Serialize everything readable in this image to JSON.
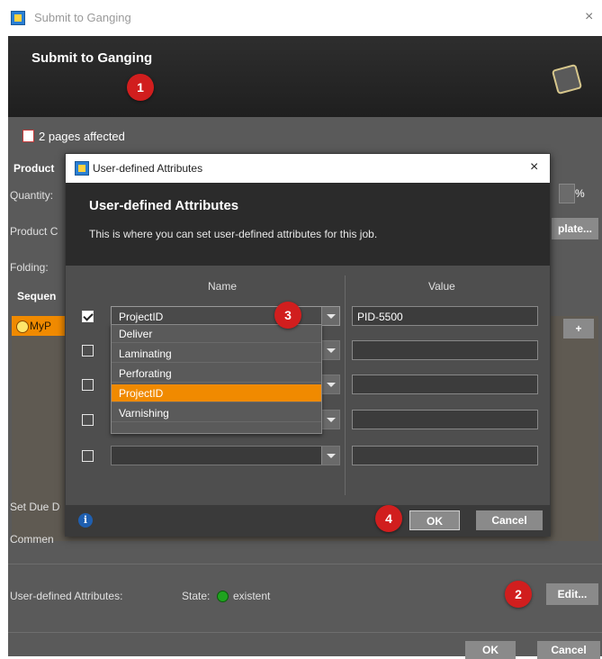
{
  "window": {
    "title": "Submit to Ganging",
    "close_glyph": "×"
  },
  "header": {
    "title": "Submit to Ganging"
  },
  "main": {
    "pages_affected": "2 pages affected",
    "labels": {
      "product": "Product",
      "quantity": "Quantity:",
      "product_c": "Product C",
      "folding": "Folding:",
      "sequence": "Sequen",
      "set_due": "Set Due D",
      "comment": "Commen"
    },
    "percent": "%",
    "plate_button": "plate...",
    "myp_item": "MyP",
    "plus_button": "+",
    "user_defined": {
      "label": "User-defined Attributes:",
      "state_label": "State:",
      "state_value": "existent",
      "state_color": "#1fa31f"
    },
    "edit_button": "Edit...",
    "ok_button": "OK",
    "cancel_button": "Cancel"
  },
  "dialog": {
    "title": "User-defined Attributes",
    "close_glyph": "×",
    "header_title": "User-defined Attributes",
    "header_subtitle": "This is where you can set user-defined attributes for this job.",
    "columns": {
      "name": "Name",
      "value": "Value"
    },
    "rows": [
      {
        "checked": true,
        "name": "ProjectID",
        "value": "PID-5500"
      },
      {
        "checked": false,
        "name": "",
        "value": ""
      },
      {
        "checked": false,
        "name": "",
        "value": ""
      },
      {
        "checked": false,
        "name": "",
        "value": ""
      },
      {
        "checked": false,
        "name": "",
        "value": ""
      }
    ],
    "dropdown_options": [
      "Deliver",
      "Laminating",
      "Perforating",
      "ProjectID",
      "Varnishing"
    ],
    "dropdown_selected": "ProjectID",
    "info_glyph": "i",
    "ok_button": "OK",
    "cancel_button": "Cancel"
  },
  "annotations": [
    "1",
    "2",
    "3",
    "4"
  ],
  "colors": {
    "accent_orange": "#f08a00",
    "badge_red": "#d11e1e",
    "header_dark": "#2b2b2b",
    "body_gray": "#5a5a5a"
  }
}
